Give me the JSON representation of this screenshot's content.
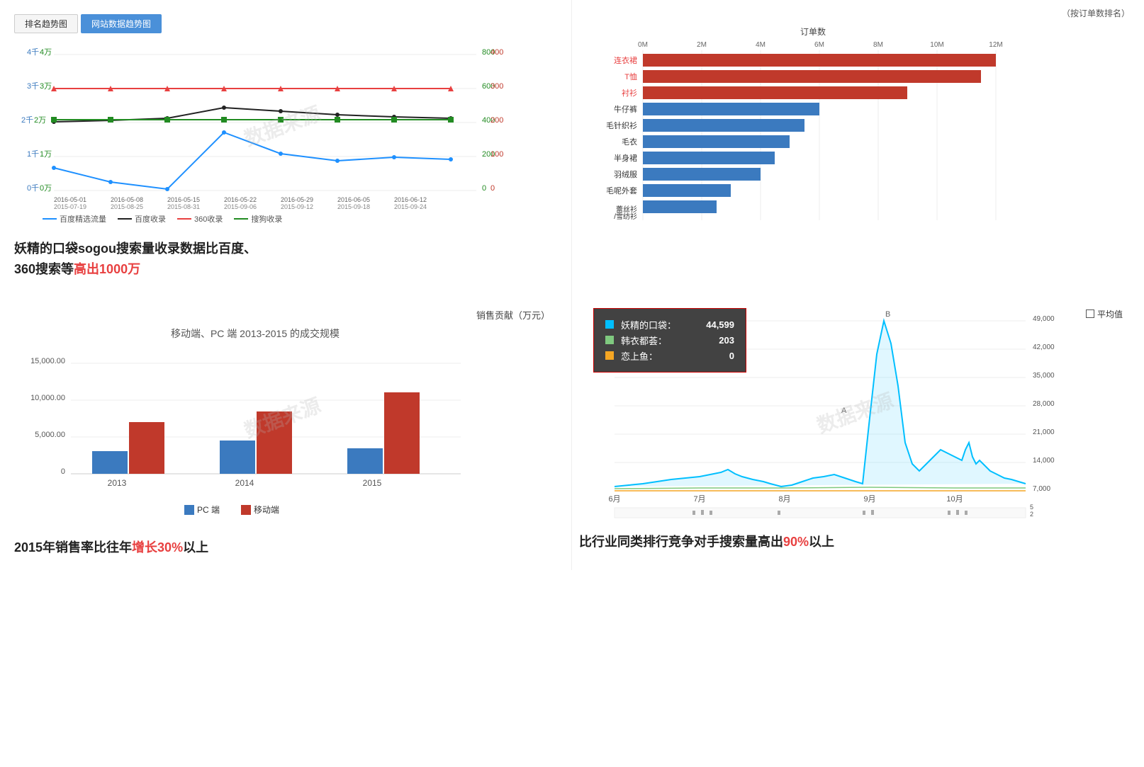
{
  "tabs": {
    "tab1": "排名趋势图",
    "tab2": "网站数据趋势图",
    "active": "tab2"
  },
  "topLeft": {
    "legend": [
      {
        "label": "百度精选流量",
        "color": "#1e90ff"
      },
      {
        "label": "百度收录",
        "color": "#222"
      },
      {
        "label": "360收录",
        "color": "#e84040"
      },
      {
        "label": "搜狗收录",
        "color": "#228b22"
      }
    ],
    "desc1": "妖精的口袋sogou搜索量收录数据比百度、",
    "desc2": "360搜索等",
    "desc3": "高出1000万"
  },
  "topRight": {
    "title": "（按订单数排名）",
    "xLabel": "订单数",
    "xTicks": [
      "0M",
      "2M",
      "4M",
      "6M",
      "8M",
      "10M",
      "12M"
    ],
    "bars": [
      {
        "label": "连衣裙",
        "value": 12,
        "color": "#c0392b"
      },
      {
        "label": "T恤",
        "value": 11.5,
        "color": "#c0392b"
      },
      {
        "label": "衬衫",
        "value": 9,
        "color": "#c0392b"
      },
      {
        "label": "牛仔裤",
        "value": 6,
        "color": "#3b7abf"
      },
      {
        "label": "毛针织衫",
        "value": 5.5,
        "color": "#3b7abf"
      },
      {
        "label": "毛衣",
        "value": 5,
        "color": "#3b7abf"
      },
      {
        "label": "半身裙",
        "value": 4.5,
        "color": "#3b7abf"
      },
      {
        "label": "羽绒服",
        "value": 4,
        "color": "#3b7abf"
      },
      {
        "label": "毛呢外套",
        "value": 3,
        "color": "#3b7abf"
      },
      {
        "label": "蕾丝衫/雪纺衫",
        "value": 2.5,
        "color": "#3b7abf"
      }
    ]
  },
  "bottomLeft": {
    "title": "移动端、PC 端 2013-2015 的成交规模",
    "yLabel": "销售贡献（万元）",
    "yTicks": [
      "15,000.00",
      "10,000.00",
      "5,000.00",
      "0"
    ],
    "groups": [
      {
        "year": "2013",
        "pc": 3000,
        "mobile": 7000
      },
      {
        "year": "2014",
        "pc": 4500,
        "mobile": 8500
      },
      {
        "year": "2015",
        "pc": 3500,
        "mobile": 11000
      }
    ],
    "legend": [
      {
        "label": "PC 端",
        "color": "#3b7abf"
      },
      {
        "label": "移动端",
        "color": "#c0392b"
      }
    ],
    "desc1": "2015年销售率比往年",
    "desc2": "增长30%",
    "desc3": "以上"
  },
  "bottomRight": {
    "tooltip": {
      "items": [
        {
          "label": "妖精的口袋：",
          "value": "44,599",
          "color": "#00bfff"
        },
        {
          "label": "韩衣都荟：",
          "value": "203",
          "color": "#7fc97f"
        },
        {
          "label": "恋上鱼：",
          "value": "0",
          "color": "#f5a623"
        }
      ]
    },
    "avgLegend": "平均值",
    "xTicks": [
      "6月",
      "7月",
      "8月",
      "9月",
      "10月"
    ],
    "yTicks": [
      "49,000",
      "42,000",
      "35,000",
      "28,000",
      "21,000",
      "14,000",
      "7,000"
    ],
    "subYTicks": [
      "5",
      "2"
    ],
    "desc1": "比行业同类排行竞争对手搜索量高出",
    "desc2": "90%",
    "desc3": "以上",
    "pointA": "A",
    "pointB": "B"
  }
}
